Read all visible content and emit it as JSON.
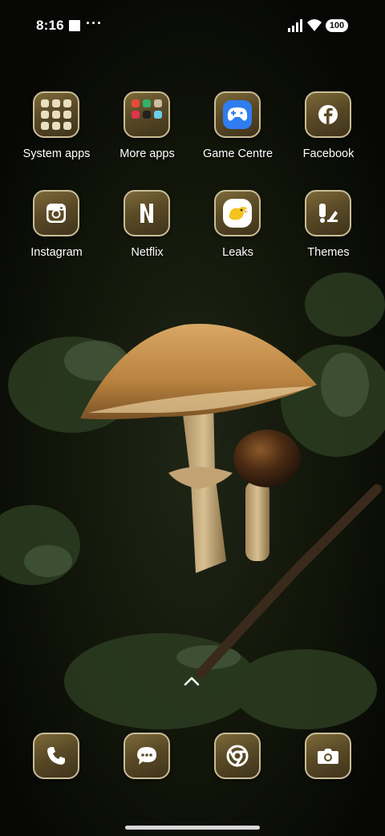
{
  "status_bar": {
    "time": "8:16",
    "more_indicator": "···",
    "battery_level": "100"
  },
  "apps": [
    {
      "label": "System apps",
      "icon": "system-apps-folder-icon"
    },
    {
      "label": "More apps",
      "icon": "more-apps-folder-icon"
    },
    {
      "label": "Game Centre",
      "icon": "game-controller-icon"
    },
    {
      "label": "Facebook",
      "icon": "facebook-icon"
    },
    {
      "label": "Instagram",
      "icon": "instagram-icon"
    },
    {
      "label": "Netflix",
      "icon": "netflix-icon"
    },
    {
      "label": "Leaks",
      "icon": "leaks-bird-icon"
    },
    {
      "label": "Themes",
      "icon": "themes-icon"
    }
  ],
  "dock": [
    {
      "icon": "phone-icon"
    },
    {
      "icon": "messages-icon"
    },
    {
      "icon": "chrome-icon"
    },
    {
      "icon": "camera-icon"
    }
  ],
  "theme": {
    "tile_gold": "#6b5a2f",
    "tile_border": "#c9bd97",
    "game_centre_blue": "#2f7df1",
    "leaks_yellow": "#f2c41d"
  }
}
